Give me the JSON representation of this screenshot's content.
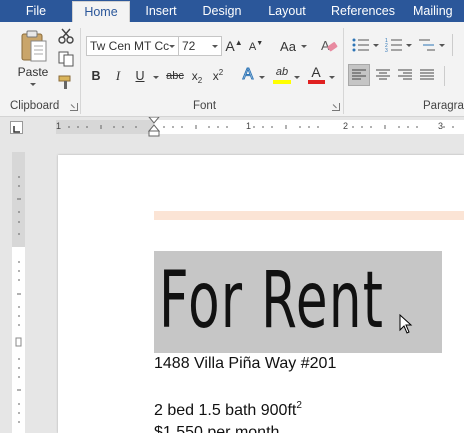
{
  "tabs": [
    {
      "label": "File",
      "active": false
    },
    {
      "label": "Home",
      "active": true
    },
    {
      "label": "Insert",
      "active": false
    },
    {
      "label": "Design",
      "active": false
    },
    {
      "label": "Layout",
      "active": false
    },
    {
      "label": "References",
      "active": false
    },
    {
      "label": "Mailing",
      "active": false
    }
  ],
  "ribbon": {
    "clipboard": {
      "paste_label": "Paste",
      "group_label": "Clipboard",
      "icons": [
        "paste-icon",
        "cut-icon",
        "copy-icon",
        "format-painter-icon"
      ]
    },
    "font": {
      "group_label": "Font",
      "font_name": "Tw Cen MT Cc",
      "font_size": "72",
      "grow_label": "A",
      "shrink_label": "A",
      "case_label": "Aa",
      "bold": "B",
      "italic": "I",
      "underline": "U",
      "strike": "abc",
      "subscript": "x",
      "subscript_mark": "2",
      "superscript": "x",
      "superscript_mark": "2",
      "text_effects": "A",
      "highlight_letters": "ab",
      "font_color": "A",
      "highlight_color": "#ffff00",
      "font_color_value": "#e02020"
    },
    "paragraph": {
      "group_label": "Paragra"
    }
  },
  "ruler": {
    "numbers": [
      "1",
      "1",
      "2",
      "3"
    ]
  },
  "document": {
    "title": "For Rent",
    "address": "1488 Villa Piña Way #201",
    "details": "2 bed 1.5 bath 900ft",
    "details_sup": "2",
    "price": "$1,550 per month"
  },
  "colors": {
    "tab_bar": "#2b579a",
    "selection": "#c6c6c6",
    "top_rule": "#fbe4d5"
  }
}
